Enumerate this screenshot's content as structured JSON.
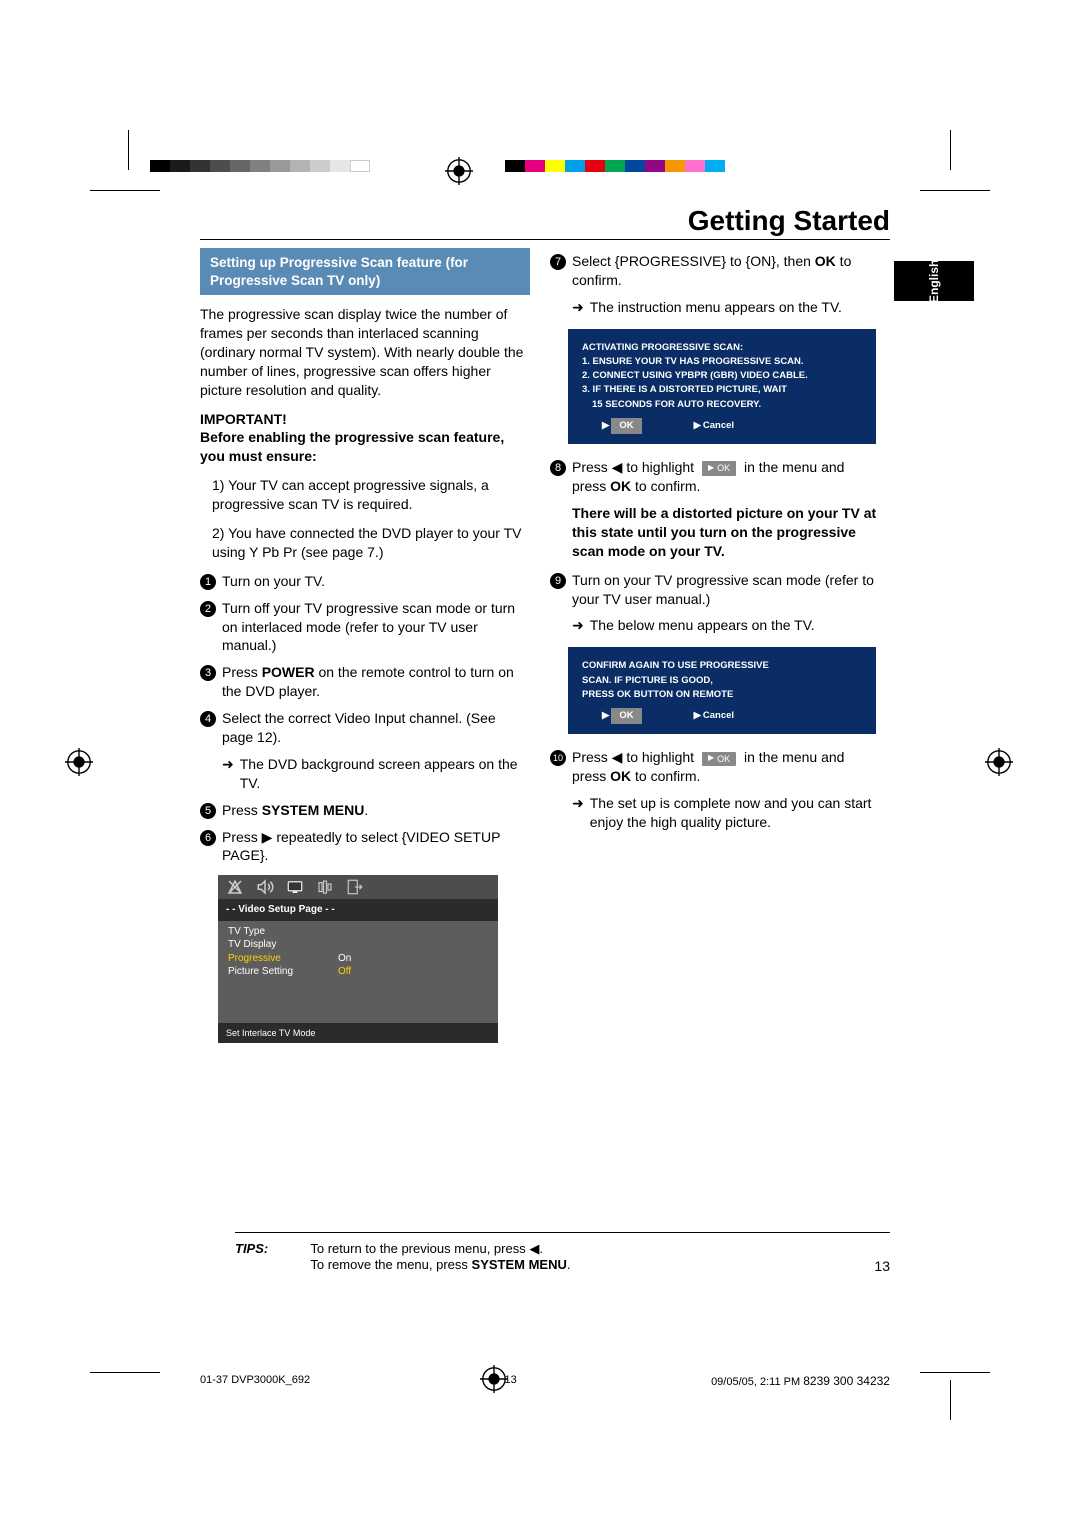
{
  "title": "Getting Started",
  "language": "English",
  "section_header": "Setting up Progressive Scan feature (for Progressive Scan TV only)",
  "intro": "The progressive scan display twice the number of frames per seconds than interlaced scanning (ordinary normal TV system). With nearly double the number of lines, progressive scan offers higher picture resolution and quality.",
  "important_label": "IMPORTANT!",
  "important_text": "Before enabling the progressive scan feature, you must ensure:",
  "precond1": "1) Your TV can accept progressive signals, a progressive scan TV is required.",
  "precond2": "2) You have connected the DVD player to your TV using Y Pb Pr (see page 7.)",
  "step1": "Turn on your TV.",
  "step2": "Turn off your TV progressive scan mode or turn on interlaced mode (refer to your TV user manual.)",
  "step3_a": "Press ",
  "step3_power": "POWER",
  "step3_b": " on the remote control to turn on the DVD player.",
  "step4_a": "Select the correct Video Input channel. (See page 12).",
  "step4_res": "The DVD background screen appears on the TV.",
  "step5_a": "Press ",
  "step5_b": "SYSTEM MENU",
  "step5_c": ".",
  "step6": "Press ▶ repeatedly to select {VIDEO SETUP PAGE}.",
  "osd_title": "- -    Video Setup Page    - -",
  "osd_row_tvtype": "TV Type",
  "osd_row_tvdisp": "TV Display",
  "osd_row_prog": "Progressive",
  "osd_val_on": "On",
  "osd_row_pic": "Picture Setting",
  "osd_val_off": "Off",
  "osd_foot": "Set Interlace TV Mode",
  "step7_a": "Select {PROGRESSIVE} to {ON}, then ",
  "step7_ok": "OK",
  "step7_b": " to confirm.",
  "step7_res": "The instruction menu appears on the TV.",
  "dlg1_line1": "ACTIVATING PROGRESSIVE SCAN:",
  "dlg1_line2": "1. ENSURE YOUR TV HAS PROGRESSIVE SCAN.",
  "dlg1_line3": "2. CONNECT USING YPBPR (GBR) VIDEO CABLE.",
  "dlg1_line4": "3. IF THERE IS A DISTORTED PICTURE, WAIT",
  "dlg1_line5": "15 SECONDS FOR AUTO RECOVERY.",
  "btn_ok": "OK",
  "btn_cancel": "Cancel",
  "step8_a": "Press ◀ to highlight ",
  "step8_b": " in the menu and press ",
  "step8_ok": "OK",
  "step8_c": " to confirm.",
  "distort_para": "There will be a distorted picture on your TV at this state until you turn on the progressive scan mode on your TV.",
  "step9": "Turn on your TV progressive scan mode (refer to your TV user manual.)",
  "step9_res": "The below menu appears on the TV.",
  "dlg2_line1": "CONFIRM AGAIN TO USE PROGRESSIVE",
  "dlg2_line2": "SCAN.  IF PICTURE IS GOOD,",
  "dlg2_line3": "PRESS OK BUTTON ON REMOTE",
  "step10_a": "Press ◀ to highlight ",
  "step10_b": " in the menu and press ",
  "step10_ok": "OK",
  "step10_c": " to confirm.",
  "step10_res": "The set up is complete now and you can start enjoy the high quality picture.",
  "tips_label": "TIPS:",
  "tips_line1": "To return to the previous menu, press ◀.",
  "tips_line2a": "To remove the menu, press ",
  "tips_line2b": "SYSTEM MENU",
  "tips_line2c": ".",
  "page_number": "13",
  "footer_file": "01-37 DVP3000K_692",
  "footer_mid": "13",
  "footer_date": "09/05/05, 2:11 PM",
  "footer_partno": "8239 300 34232"
}
